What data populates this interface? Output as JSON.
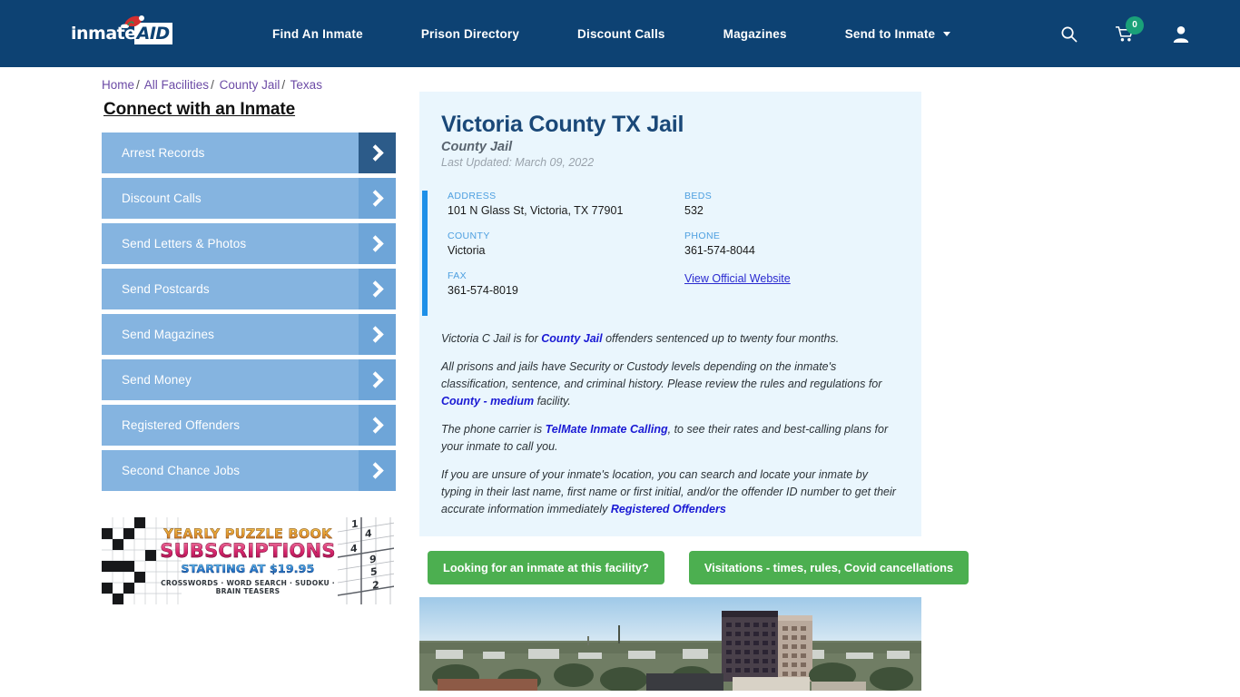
{
  "header": {
    "logo_text": "inmate",
    "logo_accent": "AID",
    "nav": [
      {
        "label": "Find An Inmate",
        "name": "find-an-inmate"
      },
      {
        "label": "Prison Directory",
        "name": "prison-directory"
      },
      {
        "label": "Discount Calls",
        "name": "discount-calls"
      },
      {
        "label": "Magazines",
        "name": "magazines"
      },
      {
        "label": "Send to Inmate",
        "name": "send-to-inmate",
        "has_dropdown": true
      }
    ],
    "icons": {
      "search": "search-icon",
      "cart": "cart-icon",
      "cart_count": "0",
      "account": "user-icon"
    },
    "background_color": "#0d4273"
  },
  "breadcrumb": {
    "items": [
      "Home",
      "All Facilities",
      "County Jail",
      "Texas"
    ],
    "separator": "/"
  },
  "sidebar": {
    "title": "Connect with an Inmate",
    "items": [
      {
        "label": "Arrest Records",
        "active": true
      },
      {
        "label": "Discount Calls",
        "active": false
      },
      {
        "label": "Send Letters & Photos",
        "active": false
      },
      {
        "label": "Send Postcards",
        "active": false
      },
      {
        "label": "Send Magazines",
        "active": false
      },
      {
        "label": "Send Money",
        "active": false
      },
      {
        "label": "Registered Offenders",
        "active": false
      },
      {
        "label": "Second Chance Jobs",
        "active": false
      }
    ],
    "ad": {
      "line1": "YEARLY PUZZLE BOOK",
      "line2": "SUBSCRIPTIONS",
      "line3": "STARTING AT $19.95",
      "line4": "CROSSWORDS · WORD SEARCH · SUDOKU · BRAIN TEASERS",
      "sudoku_numbers": [
        "1",
        "4",
        "4",
        "9",
        "5",
        "2"
      ]
    }
  },
  "facility": {
    "name": "Victoria County TX Jail",
    "type": "County Jail",
    "last_updated": "Last Updated: March 09, 2022",
    "info": {
      "address_label": "ADDRESS",
      "address_value": "101 N Glass St, Victoria, TX 77901",
      "county_label": "COUNTY",
      "county_value": "Victoria",
      "fax_label": "FAX",
      "fax_value": "361-574-8019",
      "beds_label": "BEDS",
      "beds_value": "532",
      "phone_label": "PHONE",
      "phone_value": "361-574-8044",
      "website_link": "View Official Website"
    },
    "description": {
      "p1_a": "Victoria C Jail is for ",
      "p1_link": "County Jail",
      "p1_b": " offenders sentenced up to twenty four months.",
      "p2_a": "All prisons and jails have Security or Custody levels depending on the inmate's classification, sentence, and criminal history. Please review the rules and regulations for ",
      "p2_link": "County - medium",
      "p2_b": " facility.",
      "p3_a": "The phone carrier is ",
      "p3_link": "TelMate Inmate Calling",
      "p3_b": ", to see their rates and best-calling plans for your inmate to call you.",
      "p4_a": "If you are unsure of your inmate's location, you can search and locate your inmate by typing in their last name, first name or first initial, and/or the offender ID number to get their accurate information immediately ",
      "p4_link": "Registered Offenders"
    }
  },
  "cta": {
    "inmate_search": "Looking for an inmate at this facility?",
    "visitations": "Visitations - times, rules, Covid cancellations",
    "color": "#4caf50"
  },
  "photo": {
    "alt": "Victoria Texas city skyline aerial view"
  },
  "colors": {
    "header_navy": "#0d4273",
    "panel_bg": "#eaf6fd",
    "accent_blue": "#1e90e8",
    "sidebar_blue": "#85b4e0",
    "sidebar_arrow": "#6ea5d8",
    "sidebar_arrow_active": "#2c5b89",
    "cta_green": "#4caf50",
    "link_purple": "#6c4ba6",
    "link_blue": "#1a1ad4"
  }
}
